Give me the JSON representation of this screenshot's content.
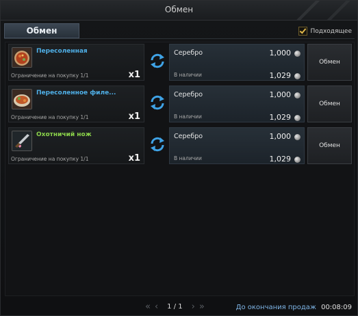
{
  "window": {
    "title": "Обмен"
  },
  "tabs": [
    {
      "label": "Обмен"
    }
  ],
  "filter": {
    "label": "Подходящее",
    "checked": true
  },
  "rows": [
    {
      "item_name": "Пересоленная",
      "name_color": "#4fb0e8",
      "limit": "Ограничение на покупку 1/1",
      "qty": "x1",
      "price_name": "Серебро",
      "price": "1,000",
      "stock_label": "В наличии",
      "stock": "1,029",
      "button": "Обмен",
      "icon": "salted-dish-icon"
    },
    {
      "item_name": "Пересоленное филе...",
      "name_color": "#4fb0e8",
      "limit": "Ограничение на покупку 1/1",
      "qty": "x1",
      "price_name": "Серебро",
      "price": "1,000",
      "stock_label": "В наличии",
      "stock": "1,029",
      "button": "Обмен",
      "icon": "salted-fillet-icon"
    },
    {
      "item_name": "Охотничий нож",
      "name_color": "#8bd34a",
      "limit": "Ограничение на покупку 1/1",
      "qty": "x1",
      "price_name": "Серебро",
      "price": "1,000",
      "stock_label": "В наличии",
      "stock": "1,029",
      "button": "Обмен",
      "icon": "hunting-knife-icon"
    }
  ],
  "pager": {
    "page": "1 / 1"
  },
  "deadline": {
    "label": "До окончания продаж",
    "time": "00:08:09"
  }
}
